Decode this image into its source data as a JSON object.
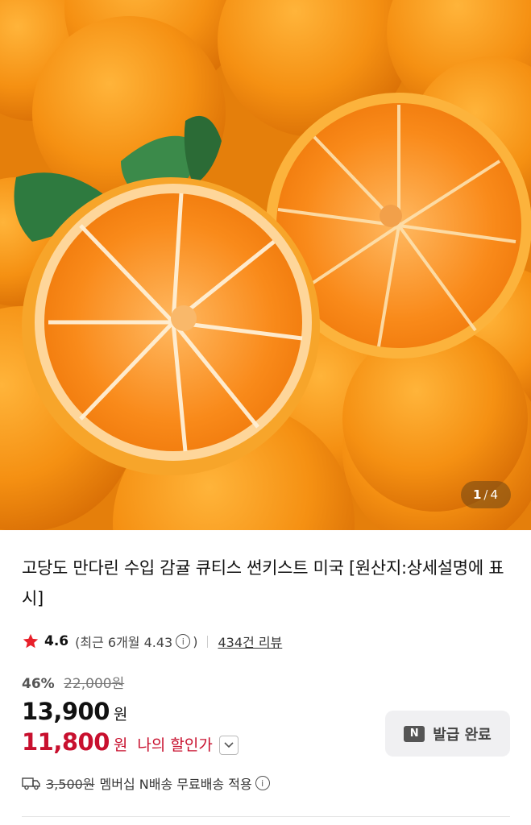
{
  "gallery": {
    "current": "1",
    "separator": "/",
    "total": "4",
    "image_desc": ""
  },
  "product": {
    "title": "고당도 만다린 수입 감귤 큐티스 썬키스트 미국 [원산지:상세설명에 표시]",
    "rating": {
      "score": "4.6",
      "recent_text": "(최근 6개월 4.43",
      "recent_close": ")",
      "info_icon": "info-icon",
      "review_link": "434건 리뷰"
    },
    "pricing": {
      "discount_percent": "46%",
      "original_price": "22,000원",
      "sale_price": "13,900",
      "currency": "원",
      "my_price": "11,800",
      "my_price_label": "나의 할인가"
    },
    "coupon": {
      "badge": "N",
      "label": "발급 완료"
    },
    "shipping": {
      "original_fee": "3,500원",
      "text": "멤버십 N배송 무료배송 적용"
    }
  },
  "colors": {
    "sale_red": "#c8102e",
    "star": "#e8202a"
  }
}
